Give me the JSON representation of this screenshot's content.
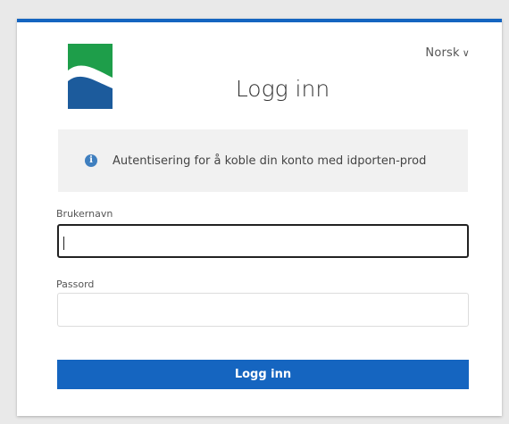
{
  "language": {
    "selected": "Norsk",
    "chevron": "∨"
  },
  "title": "Logg inn",
  "info": {
    "icon": "info-icon",
    "icon_glyph": "i",
    "message": "Autentisering for å koble din konto med idporten-prod"
  },
  "username": {
    "label": "Brukernavn",
    "value": "",
    "placeholder": ""
  },
  "password": {
    "label": "Passord",
    "value": "",
    "placeholder": ""
  },
  "submit_label": "Logg inn",
  "colors": {
    "accent": "#1565c0",
    "logo_green": "#1e9e4a",
    "logo_blue": "#1c5b9c"
  }
}
